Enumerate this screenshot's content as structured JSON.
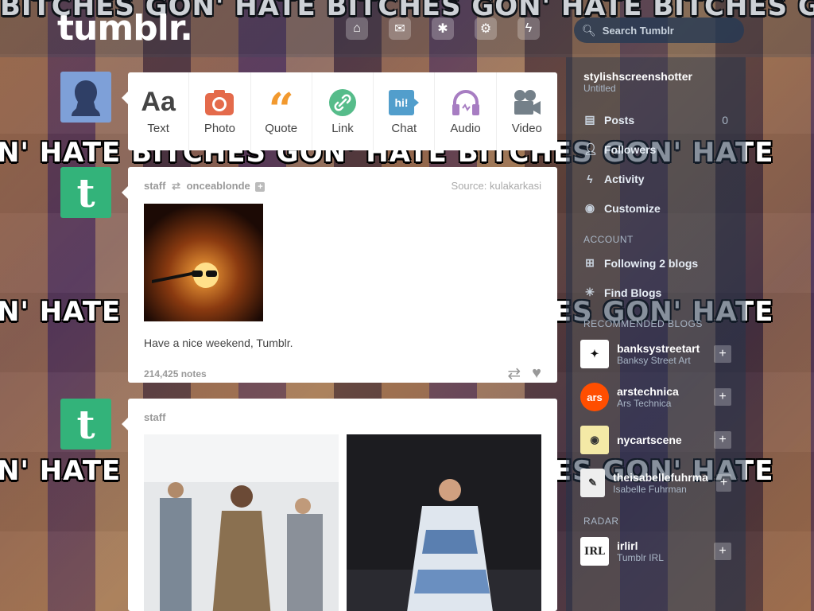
{
  "header": {
    "logo": "tumblr.",
    "search_placeholder": "Search Tumblr"
  },
  "background": {
    "meme_text": "BITCHES GON' HATE  BITCHES GON' HATE  BITCHES GON' HATE",
    "meme_text_partial": "N' HATE  BITCHES GON' HATE  BITCHES GON' HATE"
  },
  "post_bar": {
    "items": [
      {
        "label": "Text",
        "icon": "text-icon",
        "color": "#444444"
      },
      {
        "label": "Photo",
        "icon": "photo-icon",
        "color": "#e46a4b"
      },
      {
        "label": "Quote",
        "icon": "quote-icon",
        "color": "#f2992e"
      },
      {
        "label": "Link",
        "icon": "link-icon",
        "color": "#56bc8a"
      },
      {
        "label": "Chat",
        "icon": "chat-icon",
        "color": "#529ecc"
      },
      {
        "label": "Audio",
        "icon": "audio-icon",
        "color": "#a77dc2"
      },
      {
        "label": "Video",
        "icon": "video-icon",
        "color": "#748089"
      }
    ]
  },
  "posts": [
    {
      "author": "staff",
      "reblogged_from": "onceablonde",
      "source_label": "Source:",
      "source": "kulakarkasi",
      "caption": "Have a nice weekend, Tumblr.",
      "notes": "214,425 notes"
    },
    {
      "author": "staff"
    }
  ],
  "sidebar": {
    "blog_name": "stylishscreenshotter",
    "blog_subtitle": "Untitled",
    "items": [
      {
        "label": "Posts",
        "count": "0",
        "icon": "posts-icon"
      },
      {
        "label": "Followers",
        "count": "",
        "icon": "followers-icon"
      },
      {
        "label": "Activity",
        "count": "",
        "icon": "activity-icon"
      },
      {
        "label": "Customize",
        "count": "",
        "icon": "customize-icon"
      }
    ],
    "account_heading": "ACCOUNT",
    "account_items": [
      {
        "label": "Following 2 blogs",
        "icon": "following-icon"
      },
      {
        "label": "Find Blogs",
        "icon": "find-blogs-icon"
      }
    ],
    "recommended_heading": "RECOMMENDED BLOGS",
    "recommended": [
      {
        "name": "banksystreetart",
        "subtitle": "Banksy Street Art",
        "avatar_text": "",
        "color": "#ffffff"
      },
      {
        "name": "arstechnica",
        "subtitle": "Ars Technica",
        "avatar_text": "ars",
        "color": "#ff4e00"
      },
      {
        "name": "nycartscene",
        "subtitle": "",
        "avatar_text": "",
        "color": "#f4e9a6"
      },
      {
        "name": "theisabellefuhrma",
        "subtitle": "Isabelle Fuhrman",
        "avatar_text": "",
        "color": "#eeeeee"
      }
    ],
    "radar_heading": "RADAR",
    "radar": {
      "name": "irlirl",
      "subtitle": "Tumblr IRL",
      "avatar_text": "IRL"
    }
  }
}
